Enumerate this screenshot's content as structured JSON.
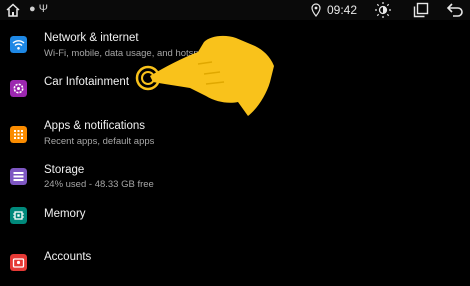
{
  "status_bar": {
    "time": "09:42",
    "notification_icons": "● Ψ",
    "icons": [
      "home-icon",
      "location-icon",
      "brightness-icon",
      "recents-icon",
      "back-icon"
    ]
  },
  "settings_items": [
    {
      "title": "Network & internet",
      "subtitle": "Wi-Fi, mobile, data usage, and hotspot",
      "icon": "wifi-icon",
      "color": "#1e88e5"
    },
    {
      "title": "Car Infotainment",
      "subtitle": "",
      "icon": "gear-icon",
      "color": "#9c27b0"
    },
    {
      "title": "Apps & notifications",
      "subtitle": "Recent apps, default apps",
      "icon": "apps-grid-icon",
      "color": "#fb8c00"
    },
    {
      "title": "Storage",
      "subtitle": "24% used - 48.33 GB free",
      "icon": "storage-icon",
      "color": "#7e57c2"
    },
    {
      "title": "Memory",
      "subtitle": "",
      "icon": "memory-icon",
      "color": "#00897b"
    },
    {
      "title": "Accounts",
      "subtitle": "",
      "icon": "account-icon",
      "color": "#e53935"
    }
  ],
  "overlay": {
    "icon": "pointing-hand-icon",
    "color": "#f9c21b"
  }
}
